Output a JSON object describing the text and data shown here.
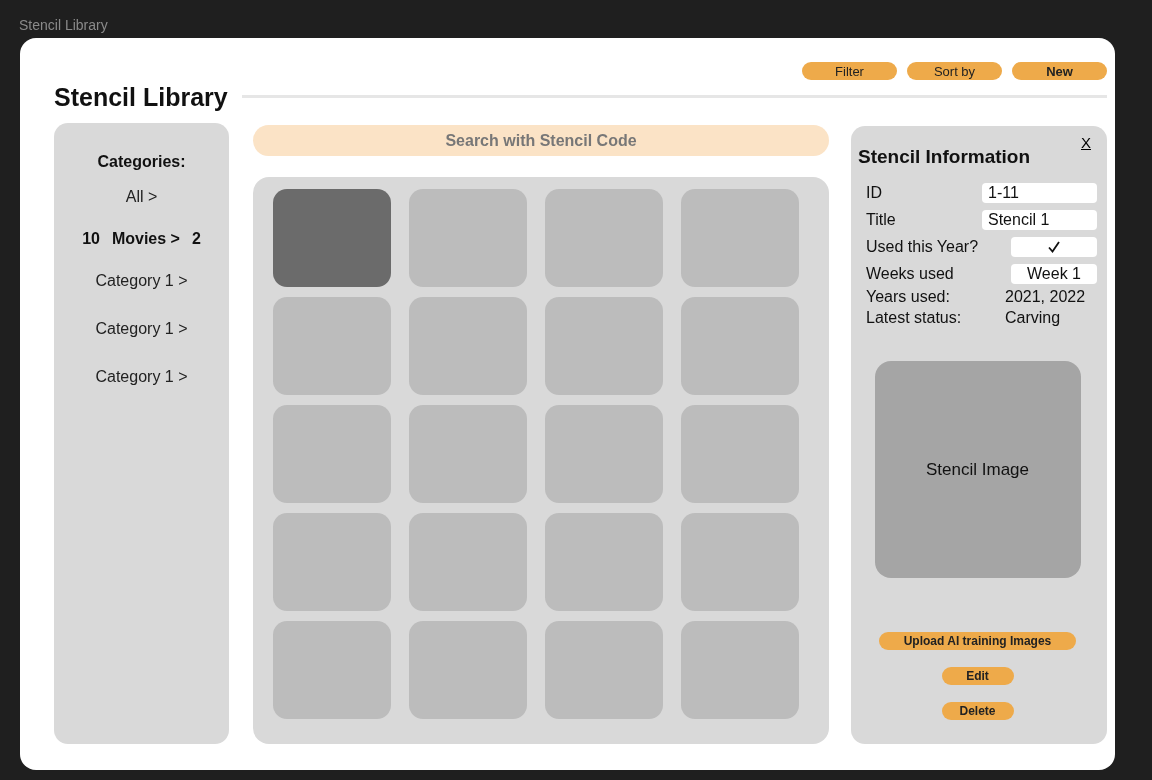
{
  "app_title": "Stencil Library",
  "header": {
    "title": "Stencil Library",
    "buttons": [
      {
        "label": "Filter",
        "emphasis": false
      },
      {
        "label": "Sort by",
        "emphasis": false
      },
      {
        "label": "New",
        "emphasis": true
      }
    ]
  },
  "sidebar": {
    "heading": "Categories:",
    "items": [
      {
        "label": "All >",
        "selected": false
      },
      {
        "label": "Movies >",
        "selected": true,
        "count_before": "10",
        "count_after": "2"
      },
      {
        "label": "Category 1 >",
        "selected": false
      },
      {
        "label": "Category 1 >",
        "selected": false
      },
      {
        "label": "Category 1 >",
        "selected": false
      }
    ]
  },
  "search": {
    "placeholder": "Search with Stencil Code"
  },
  "tiles": [
    {
      "selected": true
    },
    {
      "selected": false
    },
    {
      "selected": false
    },
    {
      "selected": false
    },
    {
      "selected": false
    },
    {
      "selected": false
    },
    {
      "selected": false
    },
    {
      "selected": false
    },
    {
      "selected": false
    },
    {
      "selected": false
    },
    {
      "selected": false
    },
    {
      "selected": false
    },
    {
      "selected": false
    },
    {
      "selected": false
    },
    {
      "selected": false
    },
    {
      "selected": false
    },
    {
      "selected": false
    },
    {
      "selected": false
    },
    {
      "selected": false
    },
    {
      "selected": false
    }
  ],
  "info": {
    "close": "X",
    "title": "Stencil Information",
    "rows": [
      {
        "kind": "field",
        "label": "ID",
        "value": "1-11"
      },
      {
        "kind": "field",
        "label": "Title",
        "value": "Stencil 1"
      },
      {
        "kind": "check",
        "label": "Used this Year?",
        "checked": true
      },
      {
        "kind": "field",
        "label": "Weeks used",
        "value": "Week 1"
      },
      {
        "kind": "text",
        "label": "Years used:",
        "value": "2021, 2022"
      },
      {
        "kind": "text",
        "label": "Latest status:",
        "value": "Carving"
      }
    ],
    "image_label": "Stencil Image",
    "buttons": [
      "Upload AI training Images",
      "Edit",
      "Delete"
    ]
  }
}
